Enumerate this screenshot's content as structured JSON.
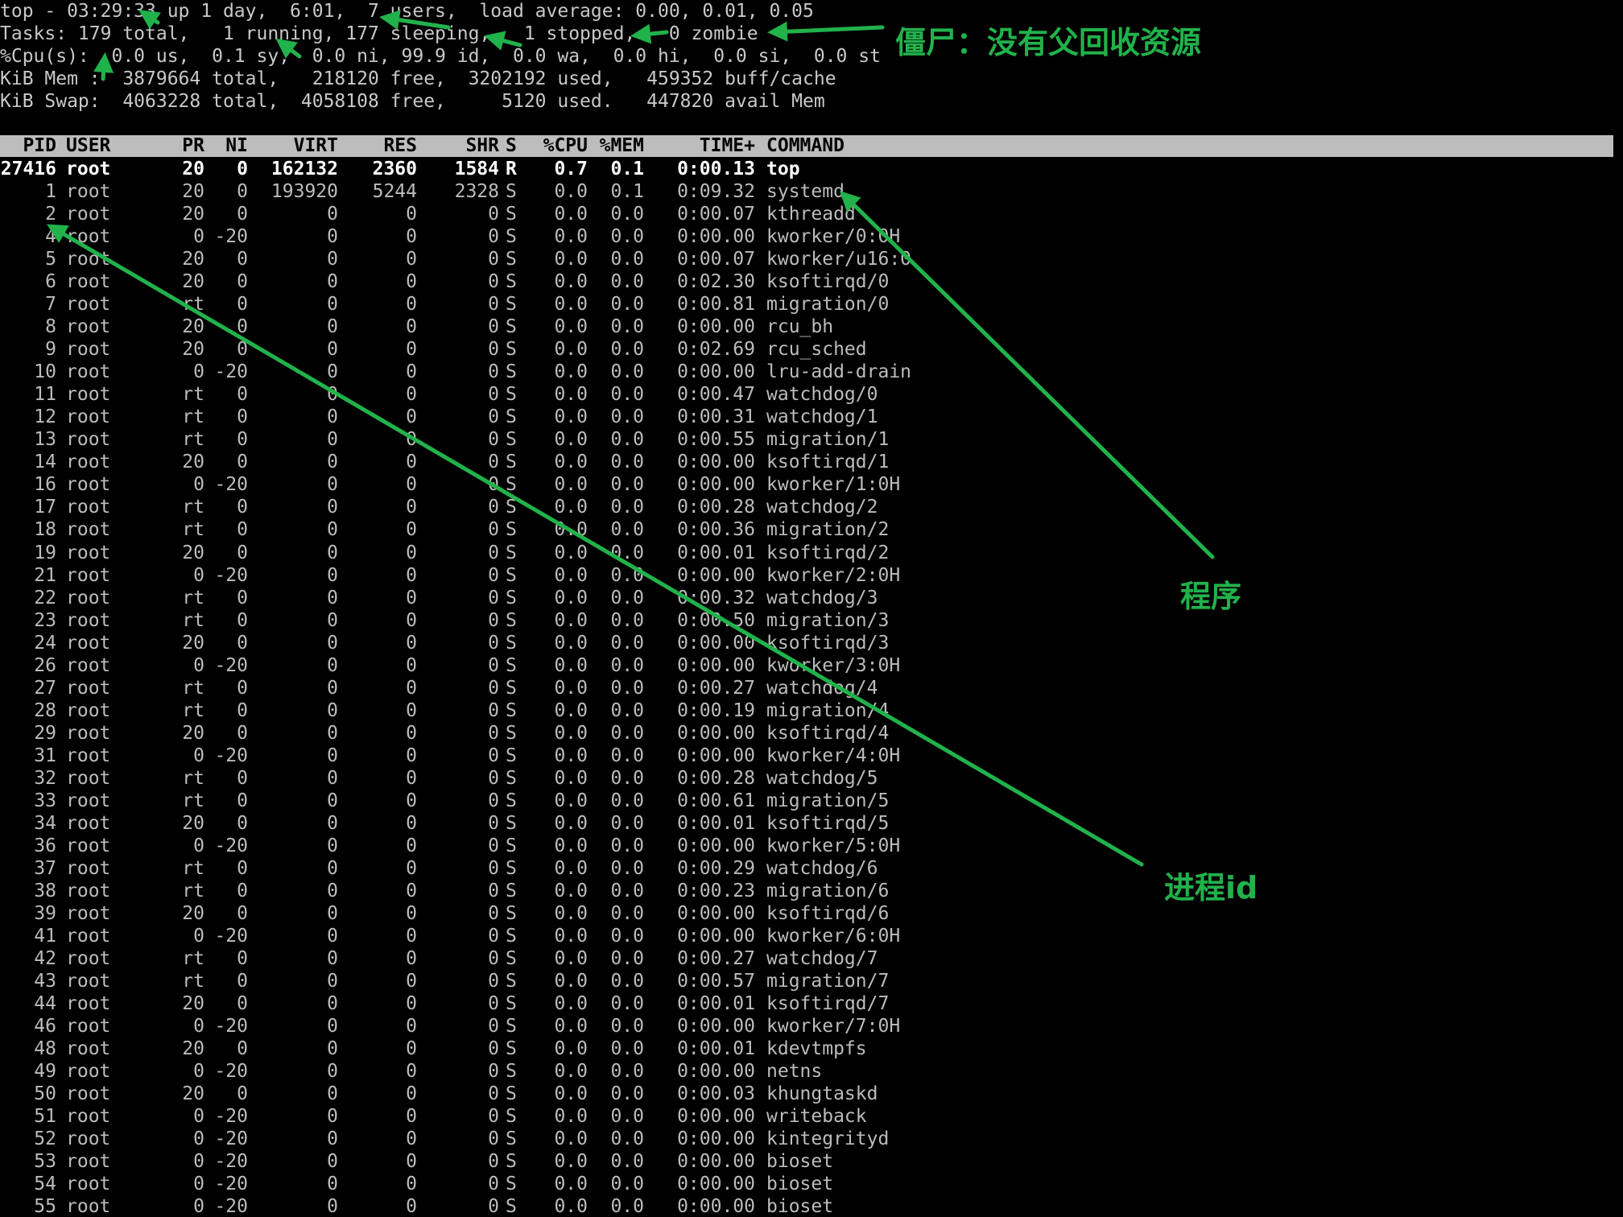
{
  "summary": {
    "line1": "top - 03:29:33 up 1 day,  6:01,  7 users,  load average: 0.00, 0.01, 0.05",
    "line2": "Tasks: 179 total,   1 running, 177 sleeping,   1 stopped,   0 zombie",
    "line3": "%Cpu(s):  0.0 us,  0.1 sy,  0.0 ni, 99.9 id,  0.0 wa,  0.0 hi,  0.0 si,  0.0 st",
    "line4": "KiB Mem :  3879664 total,   218120 free,  3202192 used,   459352 buff/cache",
    "line5": "KiB Swap:  4063228 total,  4058108 free,     5120 used.   447820 avail Mem"
  },
  "columns": [
    "PID",
    "USER",
    "PR",
    "NI",
    "VIRT",
    "RES",
    "SHR",
    "S",
    "%CPU",
    "%MEM",
    "TIME+",
    "COMMAND"
  ],
  "processes": [
    [
      "27416",
      "root",
      "20",
      "0",
      "162132",
      "2360",
      "1584",
      "R",
      "0.7",
      "0.1",
      "0:00.13",
      "top"
    ],
    [
      "1",
      "root",
      "20",
      "0",
      "193920",
      "5244",
      "2328",
      "S",
      "0.0",
      "0.1",
      "0:09.32",
      "systemd"
    ],
    [
      "2",
      "root",
      "20",
      "0",
      "0",
      "0",
      "0",
      "S",
      "0.0",
      "0.0",
      "0:00.07",
      "kthreadd"
    ],
    [
      "4",
      "root",
      "0",
      "-20",
      "0",
      "0",
      "0",
      "S",
      "0.0",
      "0.0",
      "0:00.00",
      "kworker/0:0H"
    ],
    [
      "5",
      "root",
      "20",
      "0",
      "0",
      "0",
      "0",
      "S",
      "0.0",
      "0.0",
      "0:00.07",
      "kworker/u16:0"
    ],
    [
      "6",
      "root",
      "20",
      "0",
      "0",
      "0",
      "0",
      "S",
      "0.0",
      "0.0",
      "0:02.30",
      "ksoftirqd/0"
    ],
    [
      "7",
      "root",
      "rt",
      "0",
      "0",
      "0",
      "0",
      "S",
      "0.0",
      "0.0",
      "0:00.81",
      "migration/0"
    ],
    [
      "8",
      "root",
      "20",
      "0",
      "0",
      "0",
      "0",
      "S",
      "0.0",
      "0.0",
      "0:00.00",
      "rcu_bh"
    ],
    [
      "9",
      "root",
      "20",
      "0",
      "0",
      "0",
      "0",
      "S",
      "0.0",
      "0.0",
      "0:02.69",
      "rcu_sched"
    ],
    [
      "10",
      "root",
      "0",
      "-20",
      "0",
      "0",
      "0",
      "S",
      "0.0",
      "0.0",
      "0:00.00",
      "lru-add-drain"
    ],
    [
      "11",
      "root",
      "rt",
      "0",
      "0",
      "0",
      "0",
      "S",
      "0.0",
      "0.0",
      "0:00.47",
      "watchdog/0"
    ],
    [
      "12",
      "root",
      "rt",
      "0",
      "0",
      "0",
      "0",
      "S",
      "0.0",
      "0.0",
      "0:00.31",
      "watchdog/1"
    ],
    [
      "13",
      "root",
      "rt",
      "0",
      "0",
      "0",
      "0",
      "S",
      "0.0",
      "0.0",
      "0:00.55",
      "migration/1"
    ],
    [
      "14",
      "root",
      "20",
      "0",
      "0",
      "0",
      "0",
      "S",
      "0.0",
      "0.0",
      "0:00.00",
      "ksoftirqd/1"
    ],
    [
      "16",
      "root",
      "0",
      "-20",
      "0",
      "0",
      "0",
      "S",
      "0.0",
      "0.0",
      "0:00.00",
      "kworker/1:0H"
    ],
    [
      "17",
      "root",
      "rt",
      "0",
      "0",
      "0",
      "0",
      "S",
      "0.0",
      "0.0",
      "0:00.28",
      "watchdog/2"
    ],
    [
      "18",
      "root",
      "rt",
      "0",
      "0",
      "0",
      "0",
      "S",
      "0.0",
      "0.0",
      "0:00.36",
      "migration/2"
    ],
    [
      "19",
      "root",
      "20",
      "0",
      "0",
      "0",
      "0",
      "S",
      "0.0",
      "0.0",
      "0:00.01",
      "ksoftirqd/2"
    ],
    [
      "21",
      "root",
      "0",
      "-20",
      "0",
      "0",
      "0",
      "S",
      "0.0",
      "0.0",
      "0:00.00",
      "kworker/2:0H"
    ],
    [
      "22",
      "root",
      "rt",
      "0",
      "0",
      "0",
      "0",
      "S",
      "0.0",
      "0.0",
      "0:00.32",
      "watchdog/3"
    ],
    [
      "23",
      "root",
      "rt",
      "0",
      "0",
      "0",
      "0",
      "S",
      "0.0",
      "0.0",
      "0:00.50",
      "migration/3"
    ],
    [
      "24",
      "root",
      "20",
      "0",
      "0",
      "0",
      "0",
      "S",
      "0.0",
      "0.0",
      "0:00.00",
      "ksoftirqd/3"
    ],
    [
      "26",
      "root",
      "0",
      "-20",
      "0",
      "0",
      "0",
      "S",
      "0.0",
      "0.0",
      "0:00.00",
      "kworker/3:0H"
    ],
    [
      "27",
      "root",
      "rt",
      "0",
      "0",
      "0",
      "0",
      "S",
      "0.0",
      "0.0",
      "0:00.27",
      "watchdog/4"
    ],
    [
      "28",
      "root",
      "rt",
      "0",
      "0",
      "0",
      "0",
      "S",
      "0.0",
      "0.0",
      "0:00.19",
      "migration/4"
    ],
    [
      "29",
      "root",
      "20",
      "0",
      "0",
      "0",
      "0",
      "S",
      "0.0",
      "0.0",
      "0:00.00",
      "ksoftirqd/4"
    ],
    [
      "31",
      "root",
      "0",
      "-20",
      "0",
      "0",
      "0",
      "S",
      "0.0",
      "0.0",
      "0:00.00",
      "kworker/4:0H"
    ],
    [
      "32",
      "root",
      "rt",
      "0",
      "0",
      "0",
      "0",
      "S",
      "0.0",
      "0.0",
      "0:00.28",
      "watchdog/5"
    ],
    [
      "33",
      "root",
      "rt",
      "0",
      "0",
      "0",
      "0",
      "S",
      "0.0",
      "0.0",
      "0:00.61",
      "migration/5"
    ],
    [
      "34",
      "root",
      "20",
      "0",
      "0",
      "0",
      "0",
      "S",
      "0.0",
      "0.0",
      "0:00.01",
      "ksoftirqd/5"
    ],
    [
      "36",
      "root",
      "0",
      "-20",
      "0",
      "0",
      "0",
      "S",
      "0.0",
      "0.0",
      "0:00.00",
      "kworker/5:0H"
    ],
    [
      "37",
      "root",
      "rt",
      "0",
      "0",
      "0",
      "0",
      "S",
      "0.0",
      "0.0",
      "0:00.29",
      "watchdog/6"
    ],
    [
      "38",
      "root",
      "rt",
      "0",
      "0",
      "0",
      "0",
      "S",
      "0.0",
      "0.0",
      "0:00.23",
      "migration/6"
    ],
    [
      "39",
      "root",
      "20",
      "0",
      "0",
      "0",
      "0",
      "S",
      "0.0",
      "0.0",
      "0:00.00",
      "ksoftirqd/6"
    ],
    [
      "41",
      "root",
      "0",
      "-20",
      "0",
      "0",
      "0",
      "S",
      "0.0",
      "0.0",
      "0:00.00",
      "kworker/6:0H"
    ],
    [
      "42",
      "root",
      "rt",
      "0",
      "0",
      "0",
      "0",
      "S",
      "0.0",
      "0.0",
      "0:00.27",
      "watchdog/7"
    ],
    [
      "43",
      "root",
      "rt",
      "0",
      "0",
      "0",
      "0",
      "S",
      "0.0",
      "0.0",
      "0:00.57",
      "migration/7"
    ],
    [
      "44",
      "root",
      "20",
      "0",
      "0",
      "0",
      "0",
      "S",
      "0.0",
      "0.0",
      "0:00.01",
      "ksoftirqd/7"
    ],
    [
      "46",
      "root",
      "0",
      "-20",
      "0",
      "0",
      "0",
      "S",
      "0.0",
      "0.0",
      "0:00.00",
      "kworker/7:0H"
    ],
    [
      "48",
      "root",
      "20",
      "0",
      "0",
      "0",
      "0",
      "S",
      "0.0",
      "0.0",
      "0:00.01",
      "kdevtmpfs"
    ],
    [
      "49",
      "root",
      "0",
      "-20",
      "0",
      "0",
      "0",
      "S",
      "0.0",
      "0.0",
      "0:00.00",
      "netns"
    ],
    [
      "50",
      "root",
      "20",
      "0",
      "0",
      "0",
      "0",
      "S",
      "0.0",
      "0.0",
      "0:00.03",
      "khungtaskd"
    ],
    [
      "51",
      "root",
      "0",
      "-20",
      "0",
      "0",
      "0",
      "S",
      "0.0",
      "0.0",
      "0:00.00",
      "writeback"
    ],
    [
      "52",
      "root",
      "0",
      "-20",
      "0",
      "0",
      "0",
      "S",
      "0.0",
      "0.0",
      "0:00.00",
      "kintegrityd"
    ],
    [
      "53",
      "root",
      "0",
      "-20",
      "0",
      "0",
      "0",
      "S",
      "0.0",
      "0.0",
      "0:00.00",
      "bioset"
    ],
    [
      "54",
      "root",
      "0",
      "-20",
      "0",
      "0",
      "0",
      "S",
      "0.0",
      "0.0",
      "0:00.00",
      "bioset"
    ],
    [
      "55",
      "root",
      "0",
      "-20",
      "0",
      "0",
      "0",
      "S",
      "0.0",
      "0.0",
      "0:00.00",
      "bioset"
    ]
  ],
  "annotations": {
    "zombie_note": "僵尸：没有父回收资源",
    "program_note": "程序",
    "pid_note": "进程id"
  },
  "colors": {
    "background": "#000000",
    "text": "#bcbcbc",
    "header_bar": "#bdbdbd",
    "annotation": "#21b24b"
  }
}
